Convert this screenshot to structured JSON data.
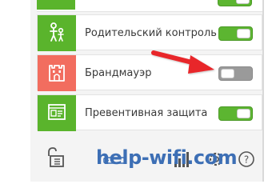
{
  "features": [
    {
      "label": "Родительский контроль",
      "icon": "parental-control-icon",
      "enabled": true
    },
    {
      "label": "Брандмауэр",
      "icon": "firewall-castle-icon",
      "enabled": false
    },
    {
      "label": "Превентивная защита",
      "icon": "proactive-protection-icon",
      "enabled": true
    }
  ],
  "watermark": "help-wifi.com",
  "colors": {
    "green": "#5ab42c",
    "red": "#f26d5f",
    "toggle_on": "#5cb531",
    "toggle_off": "#9a9a9a",
    "arrow": "#e8262a",
    "watermark": "#3d6fb5"
  },
  "bottom_icons": [
    "lock-icon",
    "router-icon",
    "signal-icon",
    "settings-icon",
    "help-icon"
  ]
}
